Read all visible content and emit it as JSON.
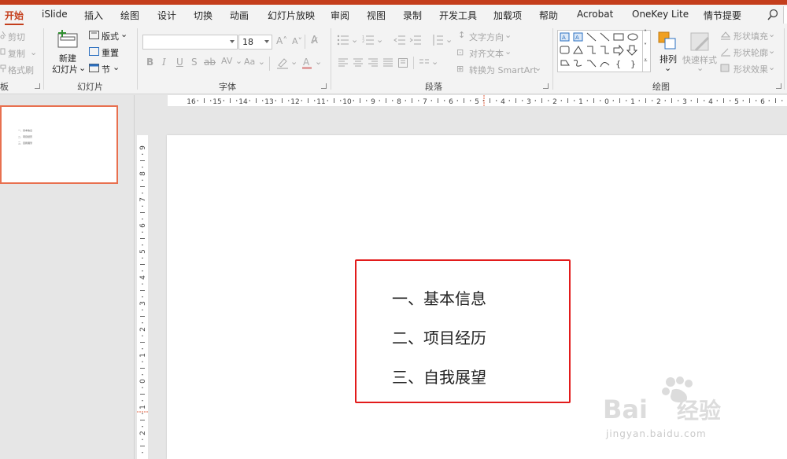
{
  "tabs": [
    "开始",
    "iSlide",
    "插入",
    "绘图",
    "设计",
    "切换",
    "动画",
    "幻灯片放映",
    "审阅",
    "视图",
    "录制",
    "开发工具",
    "加载项",
    "帮助",
    "Acrobat",
    "OneKey Lite",
    "情节提要"
  ],
  "clipboard": {
    "cut": "剪切",
    "copy": "复制",
    "format_painter": "格式刷",
    "group_label": "板"
  },
  "slides": {
    "new_slide": "新建",
    "new_slide_2": "幻灯片",
    "layout": "版式",
    "reset": "重置",
    "section": "节",
    "group_label": "幻灯片"
  },
  "font": {
    "name": "",
    "size": "18",
    "group_label": "字体"
  },
  "paragraph": {
    "text_direction": "文字方向",
    "align_text": "对齐文本",
    "convert_smartart": "转换为 SmartArt",
    "group_label": "段落"
  },
  "drawing": {
    "arrange": "排列",
    "quick_styles": "快速样式",
    "shape_fill": "形状填充",
    "shape_outline": "形状轮廓",
    "shape_effects": "形状效果",
    "group_label": "绘图"
  },
  "thumbnail": {
    "lines": [
      "一、基本信息",
      "二、项目经历",
      "三、自我展望"
    ]
  },
  "hruler_labels": [
    "16",
    "15",
    "14",
    "13",
    "12",
    "11",
    "10",
    "9",
    "8",
    "7",
    "6",
    "5",
    "4",
    "3",
    "2",
    "1",
    "0",
    "1",
    "2",
    "3",
    "4",
    "5",
    "6"
  ],
  "vruler_labels": [
    "9",
    "8",
    "7",
    "6",
    "5",
    "4",
    "3",
    "2",
    "1",
    "0",
    "1",
    "2"
  ],
  "slide": {
    "items": [
      "一、基本信息",
      "二、项目经历",
      "三、自我展望"
    ]
  },
  "watermark": {
    "text": "jingyan.baidu.com",
    "brand": "Baidu",
    "cn": "经验"
  },
  "colors": {
    "accent": "#c43e1c",
    "selection_border": "#e21b1b",
    "thumb_border": "#e8704f"
  }
}
